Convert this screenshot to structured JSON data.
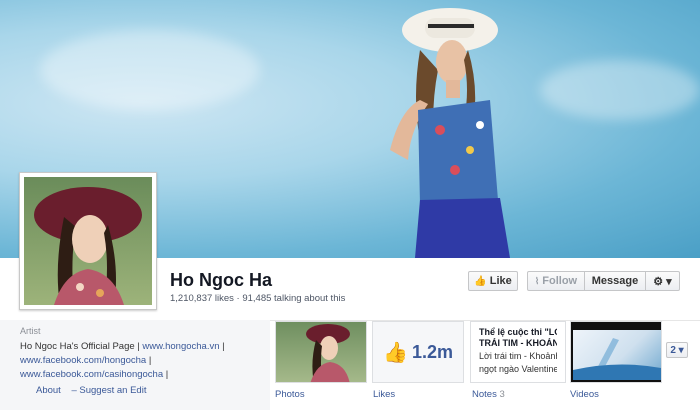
{
  "page": {
    "name": "Ho Ngoc Ha",
    "stats": "1,210,837 likes · 91,485 talking about this"
  },
  "actions": {
    "like_label": "Like",
    "follow_label": "Follow",
    "message_label": "Message",
    "settings_label": "⚙ ▾"
  },
  "about": {
    "category": "Artist",
    "description_text": "Ho Ngoc Ha's Official Page | ",
    "link1": "www.hongocha.vn",
    "sep1": " | ",
    "link2": "www.facebook.com/hongocha",
    "sep2": " | ",
    "link3": "www.facebook.com/casihongocha",
    "sep3": " |",
    "about_link": "About",
    "suggest_link": "– Suggest an Edit"
  },
  "tiles": {
    "photos_label": "Photos",
    "likes_count": "1.2m",
    "likes_label": "Likes",
    "notes_label": "Notes",
    "notes_count": "3",
    "notes_title": "Thể lệ cuộc thi \"LO",
    "notes_title2": "TRÁI TIM - KHOÁN",
    "notes_body": "Lời trái tim - Khoảnh k",
    "notes_body2": "ngọt ngào Valentine",
    "videos_label": "Videos",
    "more_label": "2 ▾"
  },
  "colors": {
    "link": "#3b5998",
    "sky": "#6cb6d6"
  }
}
